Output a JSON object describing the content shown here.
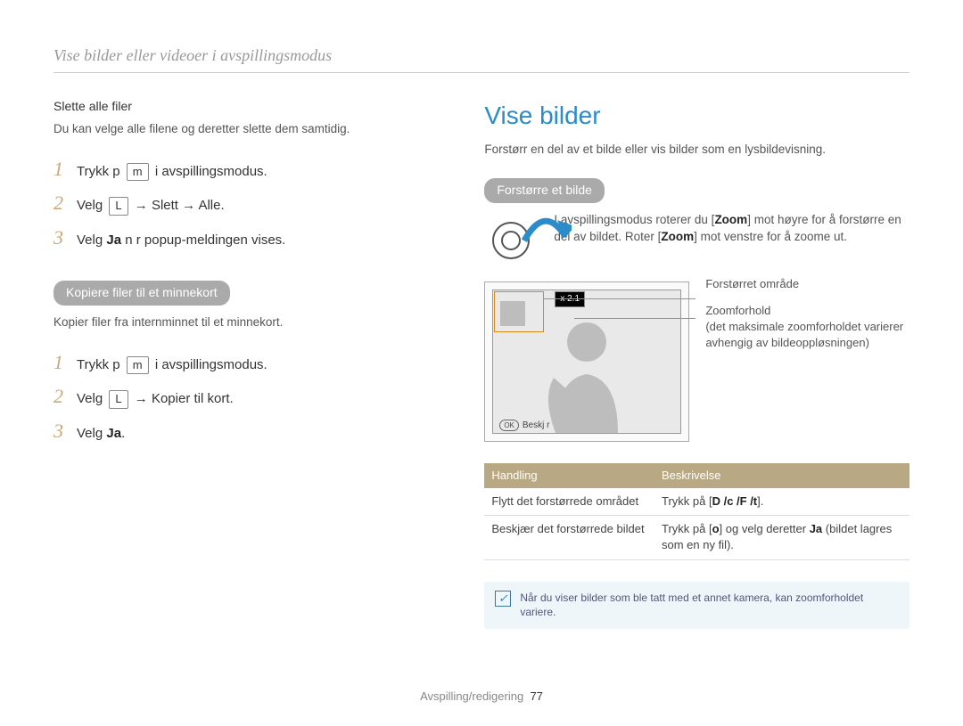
{
  "breadcrumb": "Vise bilder eller videoer i avspillingsmodus",
  "left": {
    "subhead": "Slette alle filer",
    "body": "Du kan velge alle filene og deretter slette dem samtidig.",
    "steps1": {
      "s1_a": "Trykk p",
      "s1_key": "m",
      "s1_b": "i avspillingsmodus.",
      "s2_a": "Velg",
      "s2_key": "L",
      "s2_b": "→ Slett → Alle.",
      "s3_a": "Velg",
      "s3_b": "Ja",
      "s3_c": "n r popup-meldingen vises."
    },
    "pill": "Kopiere filer til et minnekort",
    "copy_body": "Kopier filer fra internminnet til et minnekort.",
    "steps2": {
      "s1_a": "Trykk p",
      "s1_key": "m",
      "s1_b": "i avspillingsmodus.",
      "s2_a": "Velg",
      "s2_key": "L",
      "s2_b": "→ Kopier til kort.",
      "s3_a": "Velg",
      "s3_b": "Ja",
      "s3_c": "."
    }
  },
  "right": {
    "title": "Vise bilder",
    "intro": "Forstørr en del av et bilde eller vis bilder som en lysbildevisning.",
    "pill": "Forstørre et bilde",
    "zoom_text_a": "I avspillingsmodus roterer du",
    "zoom_key1": "Zoom",
    "zoom_text_b": "mot høyre for å forstørre en del av bildet. Roter",
    "zoom_key2": "Zoom",
    "zoom_text_c": "mot venstre for å zoome ut.",
    "label1": "Forstørret område",
    "label2": "Zoomforhold",
    "label2_sub": "(det maksimale zoomforholdet varierer avhengig av bildeoppløsningen)",
    "x21": "x 2.1",
    "ok": "OK",
    "crop": "Beskj r",
    "table": {
      "h1": "Handling",
      "h2": "Beskrivelse",
      "r1c1": "Flytt det forstørrede området",
      "r1c2_a": "Trykk på [",
      "r1c2_keys": "D   /c  /F  /t",
      "r1c2_b": "].",
      "r2c1": "Beskjær det forstørrede bildet",
      "r2c2_a": "Trykk på [",
      "r2c2_key": "o",
      "r2c2_b": "] og velg deretter ",
      "r2c2_c": "Ja",
      "r2c2_d": " (bildet lagres som en ny fil)."
    },
    "note": "Når du viser bilder som ble tatt med et annet kamera, kan zoomforholdet variere."
  },
  "footer": {
    "section": "Avspilling/redigering",
    "page": "77"
  }
}
